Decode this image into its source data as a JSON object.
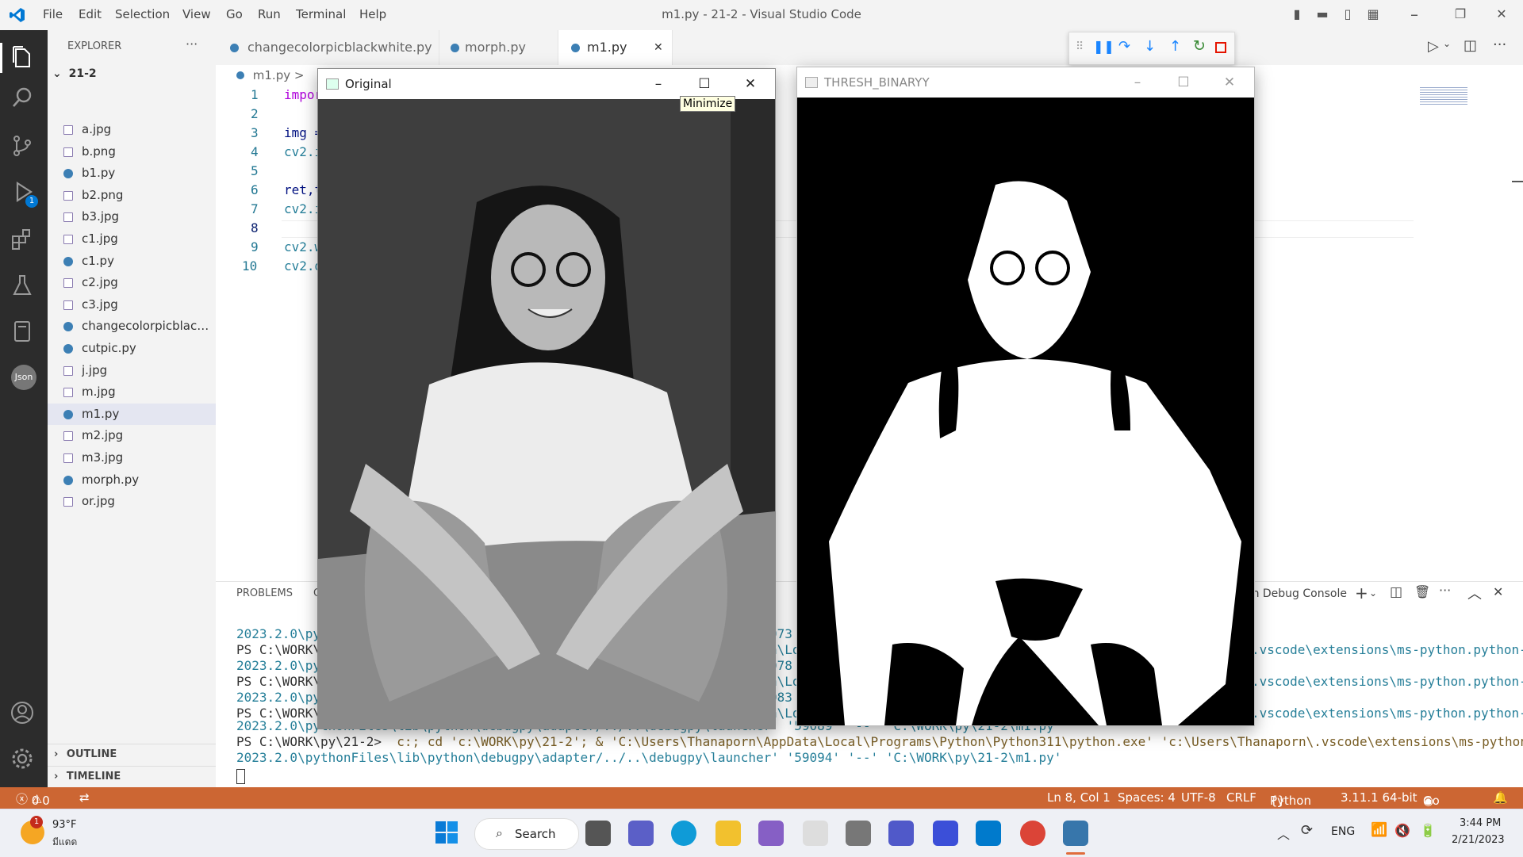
{
  "titlebar": {
    "menu": [
      "File",
      "Edit",
      "Selection",
      "View",
      "Go",
      "Run",
      "Terminal",
      "Help"
    ],
    "title": "m1.py - 21-2 - Visual Studio Code"
  },
  "activity": {
    "debug_badge": "1",
    "json_label": "Json"
  },
  "explorer": {
    "header": "EXPLORER",
    "more": "···",
    "folder": "21-2",
    "files": [
      {
        "name": "a.jpg",
        "type": "image"
      },
      {
        "name": "b.png",
        "type": "image"
      },
      {
        "name": "b1.py",
        "type": "python"
      },
      {
        "name": "b2.png",
        "type": "image"
      },
      {
        "name": "b3.jpg",
        "type": "image"
      },
      {
        "name": "c1.jpg",
        "type": "image"
      },
      {
        "name": "c1.py",
        "type": "python"
      },
      {
        "name": "c2.jpg",
        "type": "image"
      },
      {
        "name": "c3.jpg",
        "type": "image"
      },
      {
        "name": "changecolorpicblack...",
        "type": "python"
      },
      {
        "name": "cutpic.py",
        "type": "python"
      },
      {
        "name": "j.jpg",
        "type": "image"
      },
      {
        "name": "m.jpg",
        "type": "image"
      },
      {
        "name": "m1.py",
        "type": "python",
        "active": true
      },
      {
        "name": "m2.jpg",
        "type": "image"
      },
      {
        "name": "m3.jpg",
        "type": "image"
      },
      {
        "name": "morph.py",
        "type": "python"
      },
      {
        "name": "or.jpg",
        "type": "image"
      }
    ],
    "outline": "OUTLINE",
    "timeline": "TIMELINE"
  },
  "tabs": [
    {
      "label": "changecolorpicblackwhite.py",
      "active": false
    },
    {
      "label": "morph.py",
      "active": false
    },
    {
      "label": "m1.py",
      "active": true,
      "close": "✕"
    }
  ],
  "breadcrumb": "m1.py >",
  "code": [
    {
      "n": "1",
      "text": "impor",
      "color": "#af00db"
    },
    {
      "n": "2",
      "text": "",
      "color": "#333"
    },
    {
      "n": "3",
      "text": "img =",
      "color": "#001080"
    },
    {
      "n": "4",
      "text": "cv2.i",
      "color": "#267f99"
    },
    {
      "n": "5",
      "text": "",
      "color": "#333"
    },
    {
      "n": "6",
      "text": "ret,t",
      "color": "#001080"
    },
    {
      "n": "7",
      "text": "cv2.i",
      "color": "#267f99"
    },
    {
      "n": "8",
      "text": "",
      "color": "#333"
    },
    {
      "n": "9",
      "text": "cv2.w",
      "color": "#267f99"
    },
    {
      "n": "10",
      "text": "cv2.d",
      "color": "#267f99"
    }
  ],
  "panel": {
    "tab_problems": "PROBLEMS",
    "tab_partial": "O",
    "console_label": "on Debug Console",
    "terminal_left": [
      "2023.2.0\\py",
      "PS C:\\WORK\\p",
      "2023.2.0\\py",
      "PS C:\\WORK\\p",
      "2023.2.0\\py",
      "PS C:\\WORK\\p"
    ],
    "terminal_mid": [
      "973",
      "a\\Lo",
      "078",
      "a\\Lo",
      "083",
      "a\\Lo"
    ],
    "terminal_right": [
      "",
      ".vscode\\extensions\\ms-python.python-",
      "",
      ".vscode\\extensions\\ms-python.python-",
      "",
      ".vscode\\extensions\\ms-python.python-"
    ],
    "line7": "2023.2.0\\pythonFiles\\lib\\python\\debugpy\\adapter/../..\\debugpy\\launcher' '59089' '--' 'C:\\WORK\\py\\21-2\\m1.py'",
    "line8_prompt": "PS C:\\WORK\\py\\21-2> ",
    "line8_cmd": " c:; cd 'c:\\WORK\\py\\21-2'; & 'C:\\Users\\Thanaporn\\AppData\\Local\\Programs\\Python\\Python311\\python.exe' 'c:\\Users\\Thanaporn\\.vscode\\extensions\\ms-python.python-",
    "line9": "2023.2.0\\pythonFiles\\lib\\python\\debugpy\\adapter/../..\\debugpy\\launcher' '59094' '--' 'C:\\WORK\\py\\21-2\\m1.py'"
  },
  "status": {
    "errors": "0",
    "warnings": "0",
    "position": "Ln 8, Col 1",
    "spaces": "Spaces: 4",
    "encoding": "UTF-8",
    "eol": "CRLF",
    "language": "Python",
    "interpreter": "3.11.1 64-bit",
    "golive": "Go Live"
  },
  "windows": {
    "original": {
      "title": "Original",
      "tooltip": "Minimize"
    },
    "thresh": {
      "title": "THRESH_BINARYY"
    }
  },
  "taskbar": {
    "weather_temp": "93°F",
    "weather_desc": "มีแดด",
    "weather_badge": "1",
    "search": "Search",
    "lang": "ENG",
    "time": "3:44 PM",
    "date": "2/21/2023"
  },
  "colors": {
    "statusbar": "#cc6633",
    "activitybar": "#2c2c2c",
    "accent": "#007acc"
  }
}
